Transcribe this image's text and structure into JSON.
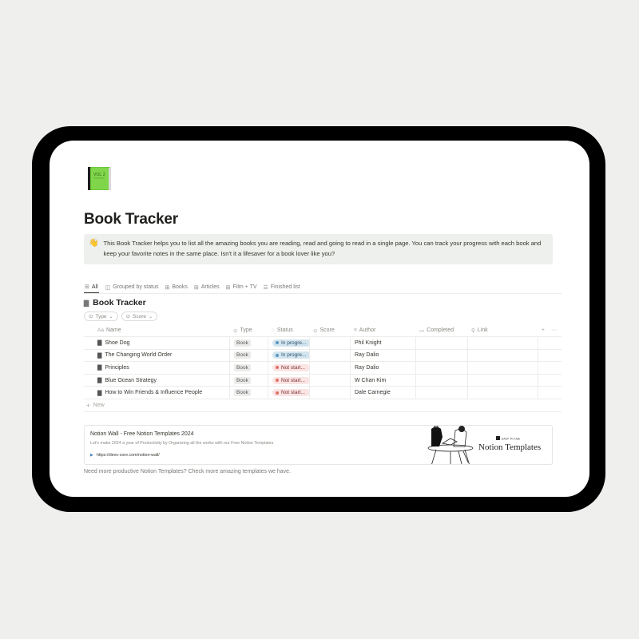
{
  "page": {
    "icon": "green-book-icon",
    "title": "Book Tracker",
    "callout": {
      "emoji": "👋",
      "text": "This Book Tracker helps you to list all the amazing books you are reading, read and going to read in a single page. You can track your progress with each book and keep your favorite notes in the same place. Isn't it a lifesaver for a book lover like you?"
    }
  },
  "views": [
    {
      "label": "All",
      "icon": "table-icon",
      "active": true
    },
    {
      "label": "Grouped by status",
      "icon": "board-icon",
      "active": false
    },
    {
      "label": "Books",
      "icon": "gallery-icon",
      "active": false
    },
    {
      "label": "Articles",
      "icon": "gallery-icon",
      "active": false
    },
    {
      "label": "Film + TV",
      "icon": "gallery-icon",
      "active": false
    },
    {
      "label": "Finished list",
      "icon": "list-icon",
      "active": false
    }
  ],
  "database": {
    "title": "Book Tracker",
    "filters": [
      {
        "label": "Type"
      },
      {
        "label": "Score"
      }
    ],
    "columns": {
      "name": "Name",
      "type": "Type",
      "status": "Status",
      "score": "Score",
      "author": "Author",
      "completed": "Completed",
      "link": "Link",
      "add": "+",
      "more": "···"
    },
    "rows": [
      {
        "name": "Shoe Dog",
        "type": "Book",
        "status": "In progre...",
        "status_kind": "prog",
        "score": "",
        "author": "Phil Knight",
        "completed": "",
        "link": ""
      },
      {
        "name": "The Changing World Order",
        "type": "Book",
        "status": "In progre...",
        "status_kind": "prog",
        "score": "",
        "author": "Ray Dalio",
        "completed": "",
        "link": ""
      },
      {
        "name": "Principles",
        "type": "Book",
        "status": "Not start...",
        "status_kind": "not",
        "score": "",
        "author": "Ray Dalio",
        "completed": "",
        "link": ""
      },
      {
        "name": "Blue Ocean Strategy",
        "type": "Book",
        "status": "Not start...",
        "status_kind": "not",
        "score": "",
        "author": "W Chan Kim",
        "completed": "",
        "link": ""
      },
      {
        "name": "How to Win Friends & Influence People",
        "type": "Book",
        "status": "Not start...",
        "status_kind": "not",
        "score": "",
        "author": "Dale Carnegie",
        "completed": "",
        "link": ""
      }
    ],
    "new_label": "New"
  },
  "bookmark": {
    "title": "Notion Wall - Free Notion Templates 2024",
    "description": "Let's make 2024 a year of Productivity by Organizing all the works with our Free Notion Templates",
    "url": "https://devs-core.com/notion-wall/",
    "image_badge": "EASY TO USE",
    "image_title": "Notion Templates"
  },
  "footer": {
    "text": "Need more productive Notion Templates? Check more amazing templates we have."
  },
  "colors": {
    "in_progress_bg": "#d3e5ef",
    "not_started_bg": "#fbe4e4",
    "callout_bg": "#edf0ec",
    "frame": "#000000",
    "background": "#efefed"
  }
}
